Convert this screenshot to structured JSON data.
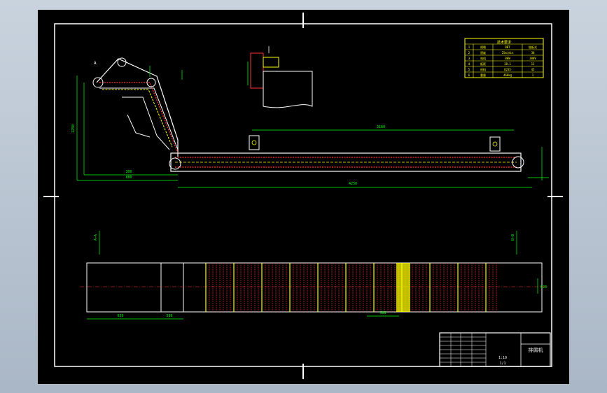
{
  "sheet": {
    "background": "#000000",
    "line_color": "#ffffff",
    "geometry_color": "#ffffff",
    "dimension_color": "#00ff00",
    "chain_color": "#ff3333",
    "highlight_color": "#ffff00"
  },
  "parts_table": {
    "header": "技术要求",
    "rows": [
      [
        "1",
        "规格",
        "DBT",
        "链板式"
      ],
      [
        "2",
        "速度",
        "25m/min",
        "30"
      ],
      [
        "3",
        "电机",
        "80W",
        "380V"
      ],
      [
        "4",
        "板距",
        "38.1",
        "12"
      ],
      [
        "5",
        "材料",
        "Q235",
        "45"
      ],
      [
        "6",
        "重量",
        "460kg",
        "1"
      ]
    ]
  },
  "top_view": {
    "dim_total": "4250",
    "dim_span": "3160",
    "dim_left_1": "300",
    "dim_left_2": "880",
    "dim_height": "1250",
    "callout": "A"
  },
  "plan_view": {
    "dim_bottom_1": "650",
    "dim_bottom_2": "580",
    "dim_mid": "500",
    "dim_width": "620",
    "label_left": "A—A",
    "label_right": "B—B"
  },
  "title_block": {
    "drawing_name": "排屑机",
    "scale": "1:10",
    "sheet": "1/1"
  }
}
